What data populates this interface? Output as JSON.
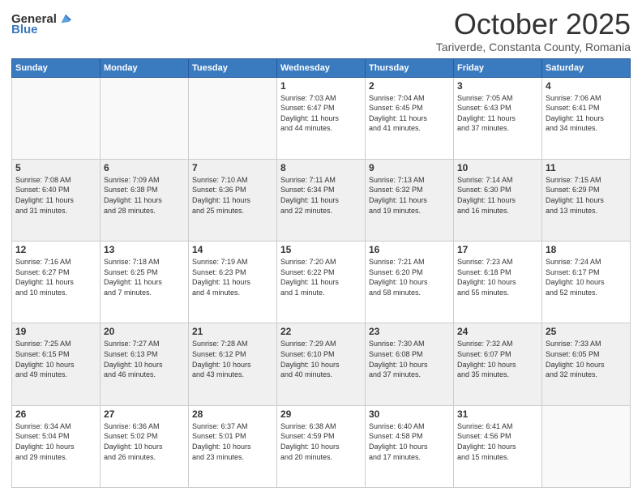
{
  "header": {
    "logo_general": "General",
    "logo_blue": "Blue",
    "month": "October 2025",
    "location": "Tariverde, Constanta County, Romania"
  },
  "weekdays": [
    "Sunday",
    "Monday",
    "Tuesday",
    "Wednesday",
    "Thursday",
    "Friday",
    "Saturday"
  ],
  "weeks": [
    [
      {
        "day": "",
        "info": ""
      },
      {
        "day": "",
        "info": ""
      },
      {
        "day": "",
        "info": ""
      },
      {
        "day": "1",
        "info": "Sunrise: 7:03 AM\nSunset: 6:47 PM\nDaylight: 11 hours\nand 44 minutes."
      },
      {
        "day": "2",
        "info": "Sunrise: 7:04 AM\nSunset: 6:45 PM\nDaylight: 11 hours\nand 41 minutes."
      },
      {
        "day": "3",
        "info": "Sunrise: 7:05 AM\nSunset: 6:43 PM\nDaylight: 11 hours\nand 37 minutes."
      },
      {
        "day": "4",
        "info": "Sunrise: 7:06 AM\nSunset: 6:41 PM\nDaylight: 11 hours\nand 34 minutes."
      }
    ],
    [
      {
        "day": "5",
        "info": "Sunrise: 7:08 AM\nSunset: 6:40 PM\nDaylight: 11 hours\nand 31 minutes."
      },
      {
        "day": "6",
        "info": "Sunrise: 7:09 AM\nSunset: 6:38 PM\nDaylight: 11 hours\nand 28 minutes."
      },
      {
        "day": "7",
        "info": "Sunrise: 7:10 AM\nSunset: 6:36 PM\nDaylight: 11 hours\nand 25 minutes."
      },
      {
        "day": "8",
        "info": "Sunrise: 7:11 AM\nSunset: 6:34 PM\nDaylight: 11 hours\nand 22 minutes."
      },
      {
        "day": "9",
        "info": "Sunrise: 7:13 AM\nSunset: 6:32 PM\nDaylight: 11 hours\nand 19 minutes."
      },
      {
        "day": "10",
        "info": "Sunrise: 7:14 AM\nSunset: 6:30 PM\nDaylight: 11 hours\nand 16 minutes."
      },
      {
        "day": "11",
        "info": "Sunrise: 7:15 AM\nSunset: 6:29 PM\nDaylight: 11 hours\nand 13 minutes."
      }
    ],
    [
      {
        "day": "12",
        "info": "Sunrise: 7:16 AM\nSunset: 6:27 PM\nDaylight: 11 hours\nand 10 minutes."
      },
      {
        "day": "13",
        "info": "Sunrise: 7:18 AM\nSunset: 6:25 PM\nDaylight: 11 hours\nand 7 minutes."
      },
      {
        "day": "14",
        "info": "Sunrise: 7:19 AM\nSunset: 6:23 PM\nDaylight: 11 hours\nand 4 minutes."
      },
      {
        "day": "15",
        "info": "Sunrise: 7:20 AM\nSunset: 6:22 PM\nDaylight: 11 hours\nand 1 minute."
      },
      {
        "day": "16",
        "info": "Sunrise: 7:21 AM\nSunset: 6:20 PM\nDaylight: 10 hours\nand 58 minutes."
      },
      {
        "day": "17",
        "info": "Sunrise: 7:23 AM\nSunset: 6:18 PM\nDaylight: 10 hours\nand 55 minutes."
      },
      {
        "day": "18",
        "info": "Sunrise: 7:24 AM\nSunset: 6:17 PM\nDaylight: 10 hours\nand 52 minutes."
      }
    ],
    [
      {
        "day": "19",
        "info": "Sunrise: 7:25 AM\nSunset: 6:15 PM\nDaylight: 10 hours\nand 49 minutes."
      },
      {
        "day": "20",
        "info": "Sunrise: 7:27 AM\nSunset: 6:13 PM\nDaylight: 10 hours\nand 46 minutes."
      },
      {
        "day": "21",
        "info": "Sunrise: 7:28 AM\nSunset: 6:12 PM\nDaylight: 10 hours\nand 43 minutes."
      },
      {
        "day": "22",
        "info": "Sunrise: 7:29 AM\nSunset: 6:10 PM\nDaylight: 10 hours\nand 40 minutes."
      },
      {
        "day": "23",
        "info": "Sunrise: 7:30 AM\nSunset: 6:08 PM\nDaylight: 10 hours\nand 37 minutes."
      },
      {
        "day": "24",
        "info": "Sunrise: 7:32 AM\nSunset: 6:07 PM\nDaylight: 10 hours\nand 35 minutes."
      },
      {
        "day": "25",
        "info": "Sunrise: 7:33 AM\nSunset: 6:05 PM\nDaylight: 10 hours\nand 32 minutes."
      }
    ],
    [
      {
        "day": "26",
        "info": "Sunrise: 6:34 AM\nSunset: 5:04 PM\nDaylight: 10 hours\nand 29 minutes."
      },
      {
        "day": "27",
        "info": "Sunrise: 6:36 AM\nSunset: 5:02 PM\nDaylight: 10 hours\nand 26 minutes."
      },
      {
        "day": "28",
        "info": "Sunrise: 6:37 AM\nSunset: 5:01 PM\nDaylight: 10 hours\nand 23 minutes."
      },
      {
        "day": "29",
        "info": "Sunrise: 6:38 AM\nSunset: 4:59 PM\nDaylight: 10 hours\nand 20 minutes."
      },
      {
        "day": "30",
        "info": "Sunrise: 6:40 AM\nSunset: 4:58 PM\nDaylight: 10 hours\nand 17 minutes."
      },
      {
        "day": "31",
        "info": "Sunrise: 6:41 AM\nSunset: 4:56 PM\nDaylight: 10 hours\nand 15 minutes."
      },
      {
        "day": "",
        "info": ""
      }
    ]
  ]
}
